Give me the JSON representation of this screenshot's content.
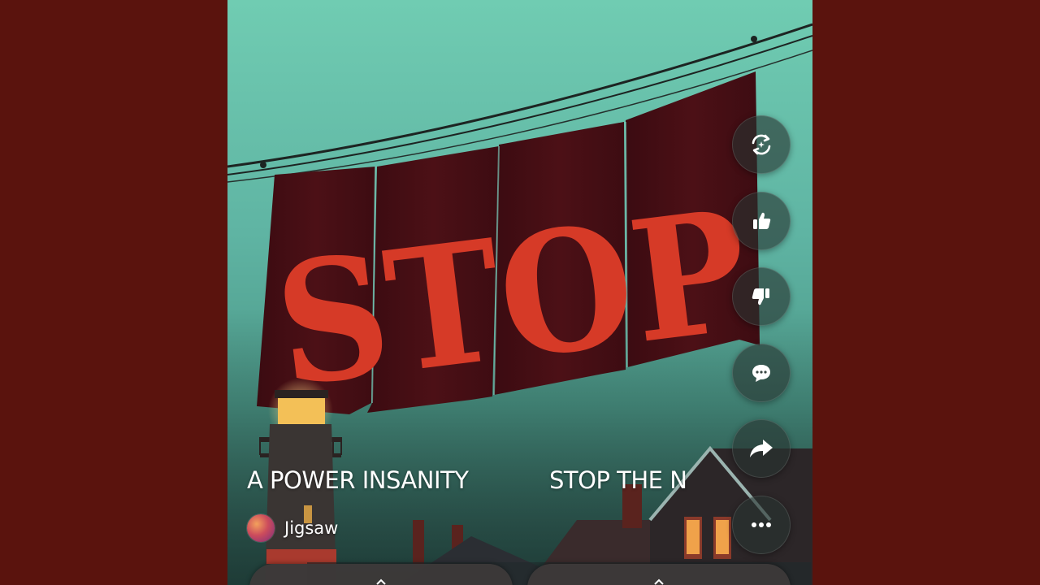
{
  "banner": {
    "word": "STOP"
  },
  "ticker": {
    "title": "A POWER INSANITY",
    "next_title": "STOP THE N"
  },
  "author": {
    "name": "Jigsaw"
  },
  "actions": [
    {
      "icon": "remix-icon",
      "label": ""
    },
    {
      "icon": "thumbs-up-icon",
      "label": ""
    },
    {
      "icon": "thumbs-down-icon",
      "label": ""
    },
    {
      "icon": "comment-icon",
      "label": ""
    },
    {
      "icon": "share-icon",
      "label": ""
    },
    {
      "icon": "more-icon",
      "label": ""
    }
  ],
  "colors": {
    "page_background": "#5a130d",
    "banner": "#4a0f15",
    "letters": "#d63a27",
    "sky": "#70ccb2"
  }
}
